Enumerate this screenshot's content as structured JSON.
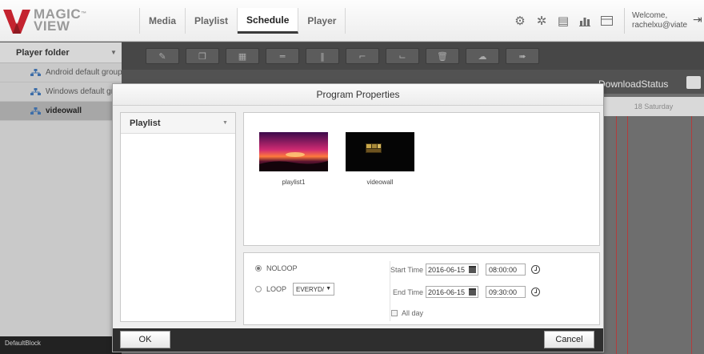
{
  "brand": {
    "logo_text_line1": "MAGIC",
    "logo_text_line2": "VIEW",
    "logo_mark": "™",
    "logo_icon": "magicview-v-logo"
  },
  "nav": {
    "tabs": [
      {
        "label": "Media",
        "active": false
      },
      {
        "label": "Playlist",
        "active": false
      },
      {
        "label": "Schedule",
        "active": true
      },
      {
        "label": "Player",
        "active": false
      }
    ]
  },
  "top_icons": [
    "settings-gears-icon",
    "gear-icon",
    "clipboard-icon",
    "bar-chart-icon",
    "screen-icon"
  ],
  "user": {
    "welcome": "Welcome,",
    "email": "rachelxu@viate"
  },
  "sidebar": {
    "header": "Player folder",
    "items": [
      {
        "label": "Android default group",
        "selected": false
      },
      {
        "label": "Windows default gro",
        "selected": false
      },
      {
        "label": "videowall",
        "selected": true
      }
    ],
    "footer_text": "DefaultBlock"
  },
  "toolbar": {
    "buttons": [
      "edit-icon",
      "copy-icon",
      "paste-icon",
      "align-center-icon",
      "align-middle-icon",
      "align-top-icon",
      "align-bottom-icon",
      "delete-icon",
      "cloud-upload-icon",
      "forward-icon"
    ]
  },
  "schedule": {
    "download_status": "DownloadStatus",
    "day_header": "18 Saturday"
  },
  "modal": {
    "title": "Program Properties",
    "playlist_select": "Playlist",
    "thumbnails": [
      {
        "label": "playlist1"
      },
      {
        "label": "videowall"
      }
    ],
    "noloop_label": "NOLOOP",
    "loop_label": "LOOP",
    "loop_value": "EVERYD/",
    "selected_mode": "NOLOOP",
    "start_time_label": "Start Time",
    "start_date": "2016-06-15",
    "start_time": "08:00:00",
    "end_time_label": "End Time",
    "end_date": "2016-06-15",
    "end_time": "09:30:00",
    "all_day_label": "All day",
    "ok_label": "OK",
    "cancel_label": "Cancel"
  },
  "colors": {
    "grid_red": "#b23c3c",
    "accent_dark": "#2e2e2e"
  }
}
